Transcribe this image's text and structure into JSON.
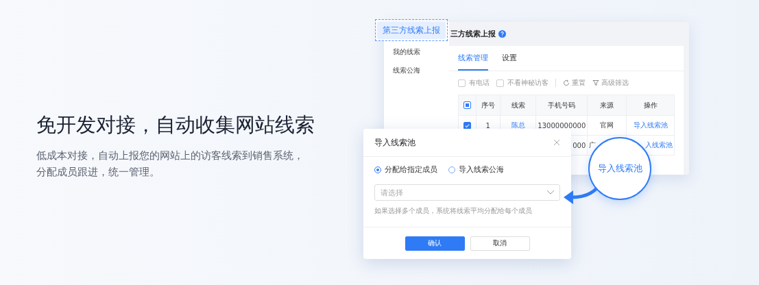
{
  "headline": "免开发对接，自动收集网站线索",
  "description_lines": [
    "低成本对接，自动上报您的网站上的访客线索到销售系统，",
    "分配成员跟进，统一管理。"
  ],
  "floating_tag": "第三方线索上报",
  "app": {
    "title": "三方线索上报",
    "sidebar": [
      {
        "label": "我的线索"
      },
      {
        "label": "线索公海"
      }
    ],
    "tabs": [
      {
        "label": "线索管理",
        "selected": true
      },
      {
        "label": "设置",
        "selected": false
      }
    ],
    "filters": [
      {
        "label": "有电话",
        "checked": false
      },
      {
        "label": "不看神秘访客",
        "checked": false
      }
    ],
    "actions": [
      {
        "kind": "reset",
        "label": "重置"
      },
      {
        "kind": "filter",
        "label": "高级筛选"
      }
    ],
    "table": {
      "header_checked": true,
      "columns": [
        "序号",
        "线索",
        "手机号码",
        "来源",
        "操作"
      ],
      "rows": [
        {
          "selected": true,
          "cells": [
            "1",
            "陈总",
            "13000000000",
            "官网",
            "导入线索池"
          ]
        },
        {
          "cells": [
            "",
            "",
            "000",
            "广",
            "入线索池"
          ]
        }
      ]
    }
  },
  "dialog": {
    "title": "导入线索池",
    "radios": [
      {
        "label": "分配给指定成员",
        "selected": true
      },
      {
        "label": "导入线索公海",
        "selected": false
      }
    ],
    "select": {
      "placeholder": "请选择"
    },
    "hint": "如果选择多个成员，系统将线索平均分配给每个成员",
    "buttons": [
      {
        "kind": "primary",
        "label": "确认"
      },
      {
        "kind": "default",
        "label": "取消"
      }
    ]
  },
  "magnifier": {
    "label": "导入线索池"
  }
}
